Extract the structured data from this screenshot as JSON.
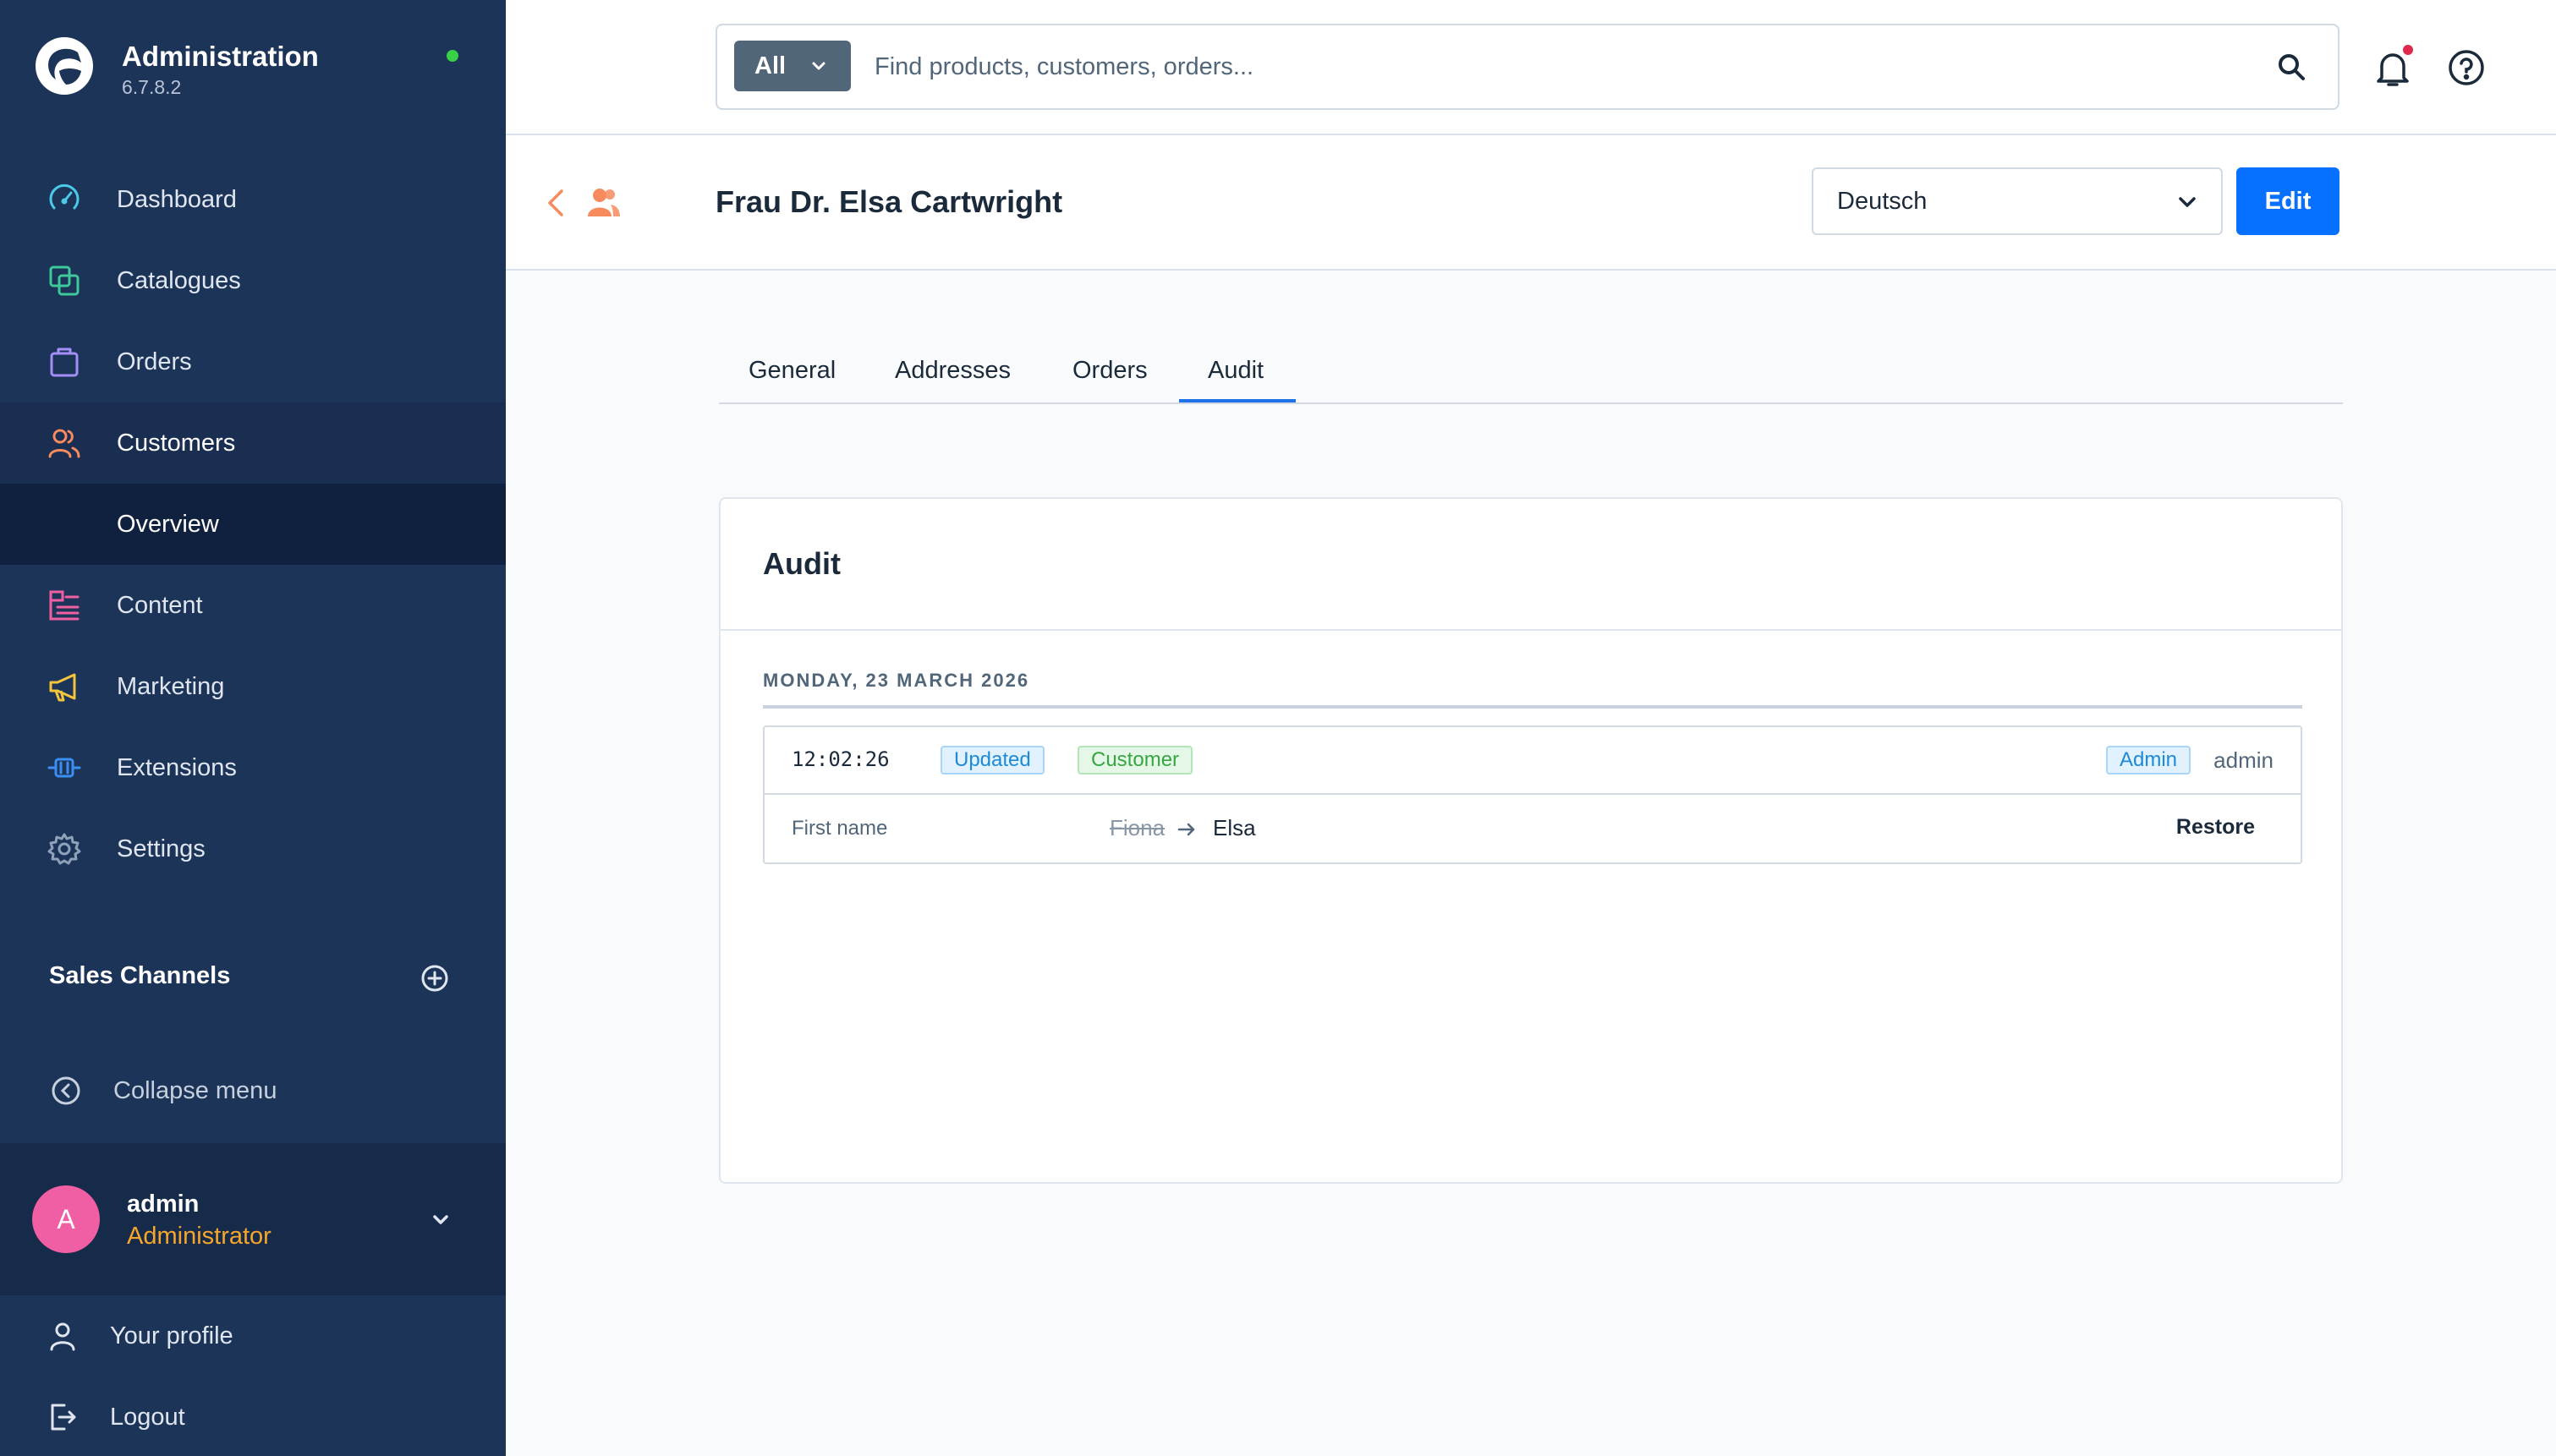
{
  "app": {
    "title": "Administration",
    "version": "6.7.8.2"
  },
  "sidebar": {
    "items": [
      {
        "label": "Dashboard"
      },
      {
        "label": "Catalogues"
      },
      {
        "label": "Orders"
      },
      {
        "label": "Customers"
      },
      {
        "label": "Overview"
      },
      {
        "label": "Content"
      },
      {
        "label": "Marketing"
      },
      {
        "label": "Extensions"
      },
      {
        "label": "Settings"
      }
    ],
    "sales_channels": "Sales Channels",
    "collapse": "Collapse menu",
    "user": {
      "initial": "A",
      "name": "admin",
      "role": "Administrator"
    },
    "profile": "Your profile",
    "logout": "Logout"
  },
  "search": {
    "scope": "All",
    "placeholder": "Find products, customers, orders..."
  },
  "page": {
    "title": "Frau Dr. Elsa Cartwright",
    "language": "Deutsch",
    "edit_label": "Edit"
  },
  "tabs": [
    {
      "label": "General"
    },
    {
      "label": "Addresses"
    },
    {
      "label": "Orders"
    },
    {
      "label": "Audit"
    }
  ],
  "audit": {
    "title": "Audit",
    "date": "MONDAY, 23 MARCH 2026",
    "entry": {
      "time": "12:02:26",
      "action": "Updated",
      "entity": "Customer",
      "actor_role": "Admin",
      "actor": "admin",
      "field": "First name",
      "old_value": "Fiona",
      "new_value": "Elsa",
      "restore_label": "Restore"
    }
  },
  "colors": {
    "sidebar": "#1d3459",
    "accent": "#0870ff",
    "status_online": "#37d046",
    "notification": "#de294c",
    "avatar": "#f05fa3",
    "role": "#f7a52b"
  }
}
